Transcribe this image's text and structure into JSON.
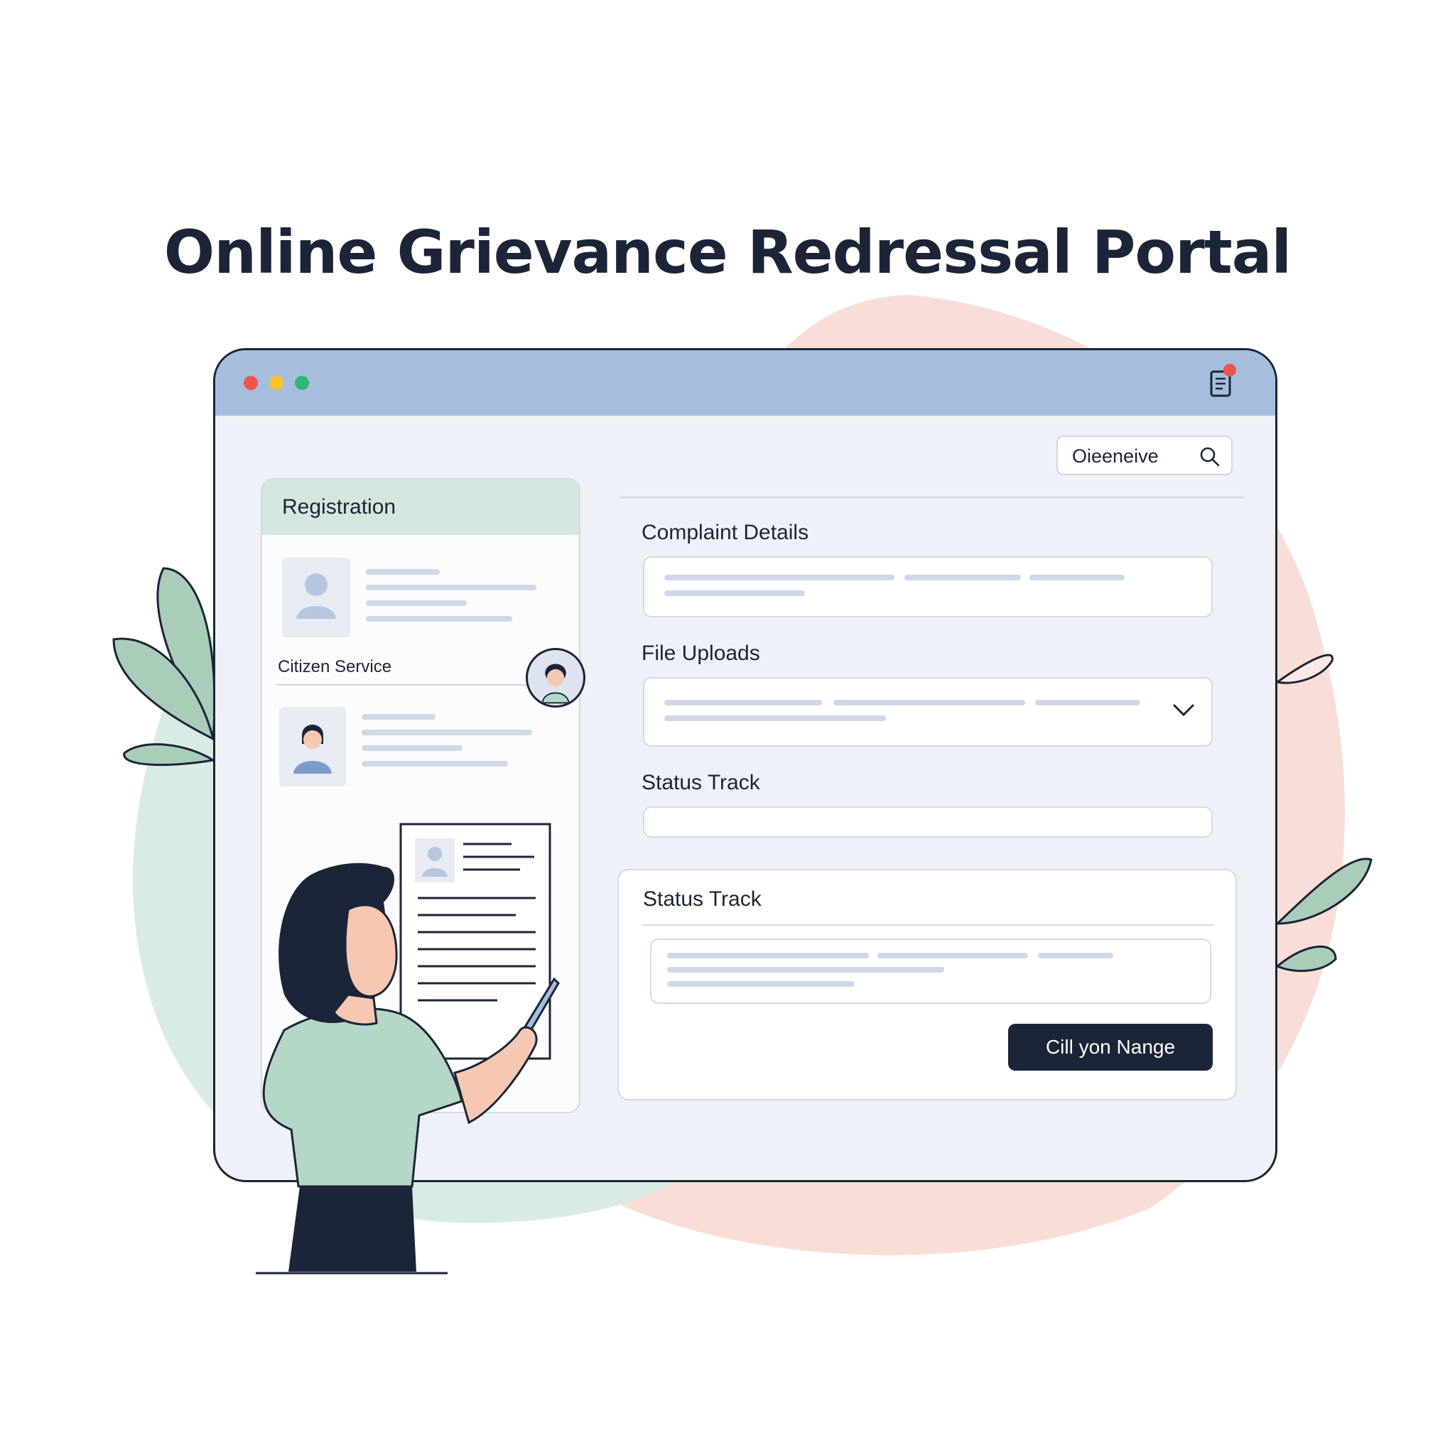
{
  "page": {
    "title": "Online Grievance Redressal Portal"
  },
  "window": {
    "search": {
      "value": "Oieeneive"
    },
    "sidebar": {
      "title": "Registration",
      "citizen_label": "Citizen Service"
    },
    "form": {
      "complaint_label": "Complaint Details",
      "uploads_label": "File Uploads",
      "status_label": "Status Track",
      "status_card_title": "Status Track",
      "action_button": "Cill yon Nange"
    }
  },
  "colors": {
    "titlebar": "#a5bede",
    "accent_dark": "#1c2437",
    "sidebar_header": "#d4e7df",
    "shirt": "#b5d8c6",
    "blob_pink": "#f8ded7",
    "blob_green": "#d9ebe5"
  },
  "icons": [
    "search-icon",
    "notification-icon",
    "chevron-down-icon",
    "user-avatar-icon",
    "plant-icon"
  ]
}
